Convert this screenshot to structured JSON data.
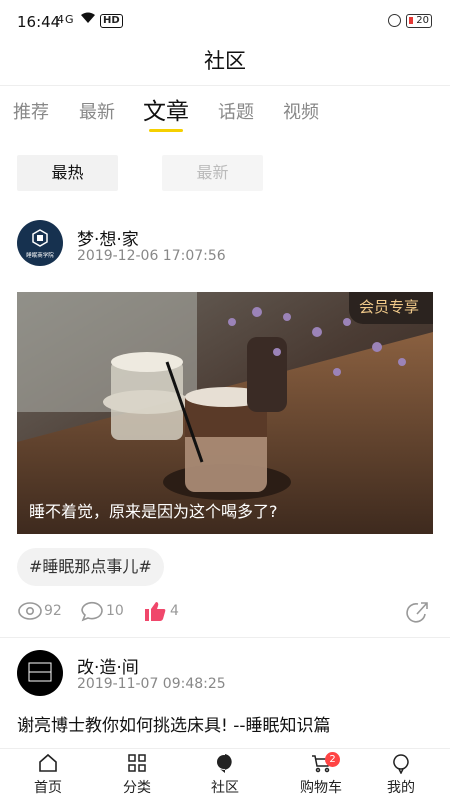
{
  "status_bar": {
    "time": "16:44",
    "signal": "4G",
    "hd": "HD",
    "battery": "20"
  },
  "header": {
    "title": "社区"
  },
  "tabs": [
    {
      "label": "推荐"
    },
    {
      "label": "最新"
    },
    {
      "label": "文章"
    },
    {
      "label": "话题"
    },
    {
      "label": "视频"
    }
  ],
  "filters": {
    "hot": "最热",
    "new": "最新"
  },
  "post1": {
    "author": "梦·想·家",
    "date": "2019-12-06 17:07:56",
    "avatar_text": "睡眠商学院",
    "badge": "会员专享",
    "caption": "睡不着觉，原来是因为这个喝多了?",
    "tag": "#睡眠那点事儿#",
    "views": "92",
    "comments": "10",
    "likes": "4"
  },
  "post2": {
    "author": "改·造·间",
    "date": "2019-11-07 09:48:25",
    "title": "谢亮博士教你如何挑选床具! --睡眠知识篇"
  },
  "nav": [
    {
      "label": "首页",
      "icon": "home-icon"
    },
    {
      "label": "分类",
      "icon": "grid-icon"
    },
    {
      "label": "社区",
      "icon": "community-icon"
    },
    {
      "label": "购物车",
      "icon": "cart-icon",
      "badge": "2"
    },
    {
      "label": "我的",
      "icon": "profile-icon"
    }
  ],
  "colors": {
    "accent": "#f5d000",
    "like": "#f0476b",
    "badge_bg": "#2b231f",
    "badge_text": "#f0c98a"
  }
}
